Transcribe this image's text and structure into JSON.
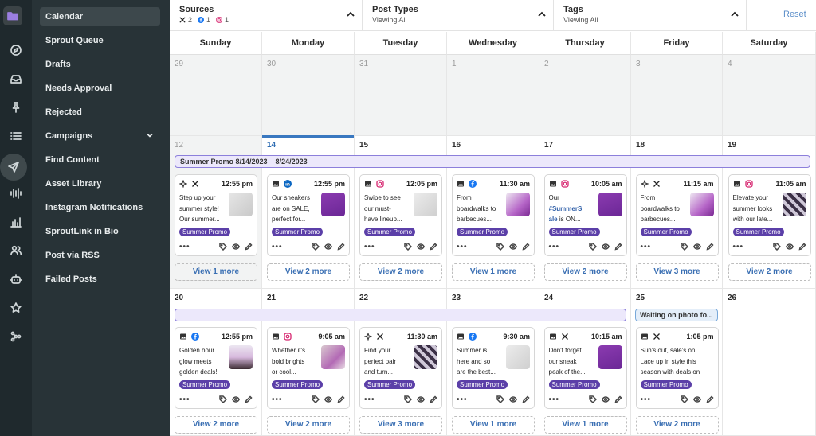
{
  "sidenav": {
    "items": [
      "Calendar",
      "Sprout Queue",
      "Drafts",
      "Needs Approval",
      "Rejected",
      "Campaigns",
      "Find Content",
      "Asset Library",
      "Instagram Notifications",
      "SproutLink in Bio",
      "Post via RSS",
      "Failed Posts"
    ]
  },
  "rail_icons": [
    "folder-icon",
    "compass-icon",
    "inbox-icon",
    "pin-icon",
    "list-icon",
    "send-icon",
    "audio-wave-icon",
    "bar-chart-icon",
    "people-icon",
    "bot-icon",
    "star-icon",
    "network-icon"
  ],
  "filters": {
    "sources": {
      "title": "Sources",
      "x_count": "2",
      "fb_count": "1",
      "ig_count": "1"
    },
    "post_types": {
      "title": "Post Types",
      "sub": "Viewing All"
    },
    "tags": {
      "title": "Tags",
      "sub": "Viewing All"
    },
    "reset": "Reset"
  },
  "weekdays": [
    "Sunday",
    "Monday",
    "Tuesday",
    "Wednesday",
    "Thursday",
    "Friday",
    "Saturday"
  ],
  "weeks": [
    [
      "29",
      "30",
      "31",
      "1",
      "2",
      "3",
      "4"
    ],
    [
      "12",
      "14",
      "15",
      "16",
      "17",
      "18",
      "19"
    ],
    [
      "20",
      "21",
      "22",
      "23",
      "24",
      "25",
      "26"
    ]
  ],
  "campaign_label": "Summer Promo  8/14/2023 – 8/24/2023",
  "waiting_label": "Waiting on photo fo...",
  "tag_label": "Summer Promo",
  "week2_posts": [
    {
      "net": "x",
      "time": "12:55 pm",
      "text": "Step up your\nsummer style!\nOur summer...",
      "thumb": "shoe",
      "kind": "sparkle"
    },
    {
      "net": "li",
      "time": "12:55 pm",
      "text": "Our sneakers\nare on SALE,\nperfect for...",
      "thumb": "purple",
      "kind": "photo"
    },
    {
      "net": "ig",
      "time": "12:05 pm",
      "text": "Swipe to see\nour must-\nhave lineup...",
      "thumb": "grey",
      "kind": "photo"
    },
    {
      "net": "fb",
      "time": "11:30 am",
      "text": "From\nboardwalks to\nbarbecues...",
      "thumb": "person",
      "kind": "photo"
    },
    {
      "net": "ig",
      "time": "10:05 am",
      "text": "Our\n#SummerS\nale is ON...",
      "thumb": "purple",
      "kind": "photo"
    },
    {
      "net": "x",
      "time": "11:15 am",
      "text": "From\nboardwalks to\nbarbecues...",
      "thumb": "person",
      "kind": "sparkle"
    },
    {
      "net": "ig",
      "time": "11:05 am",
      "text": "Elevate your\nsummer looks\nwith our late...",
      "thumb": "pattern",
      "kind": "photo"
    }
  ],
  "week2_more": [
    "View 1 more",
    "View 2 more",
    "View 2 more",
    "View 1 more",
    "View 2 more",
    "View 3 more",
    "View 2 more"
  ],
  "week3_posts": [
    {
      "net": "fb",
      "time": "12:55 pm",
      "text": "Golden hour\nglow meets\ngolden deals!",
      "thumb": "dancer",
      "kind": "photo"
    },
    {
      "net": "ig",
      "time": "9:05 am",
      "text": "Whether it's\nbold brights\nor cool...",
      "thumb": "jump",
      "kind": "photo"
    },
    {
      "net": "x",
      "time": "11:30 am",
      "text": "Find your\nperfect pair\nand turn...",
      "thumb": "pattern",
      "kind": "sparkle"
    },
    {
      "net": "fb",
      "time": "9:30 am",
      "text": "Summer is\nhere and so\nare the best...",
      "thumb": "grey",
      "kind": "photo"
    },
    {
      "net": "x",
      "time": "10:15 am",
      "text": "Don't forget\nour sneak\npeak of the...",
      "thumb": "purple",
      "kind": "photo"
    },
    {
      "net": "x",
      "time": "1:05 pm",
      "text": "Sun's out, sale's on!\nLace up in style this\nseason with deals on\nour hottest sneakers.",
      "thumb": "",
      "kind": "photo"
    }
  ],
  "week3_more": [
    "View 2 more",
    "View 2 more",
    "View 3 more",
    "View 1 more",
    "View 1 more",
    "View 2 more"
  ]
}
